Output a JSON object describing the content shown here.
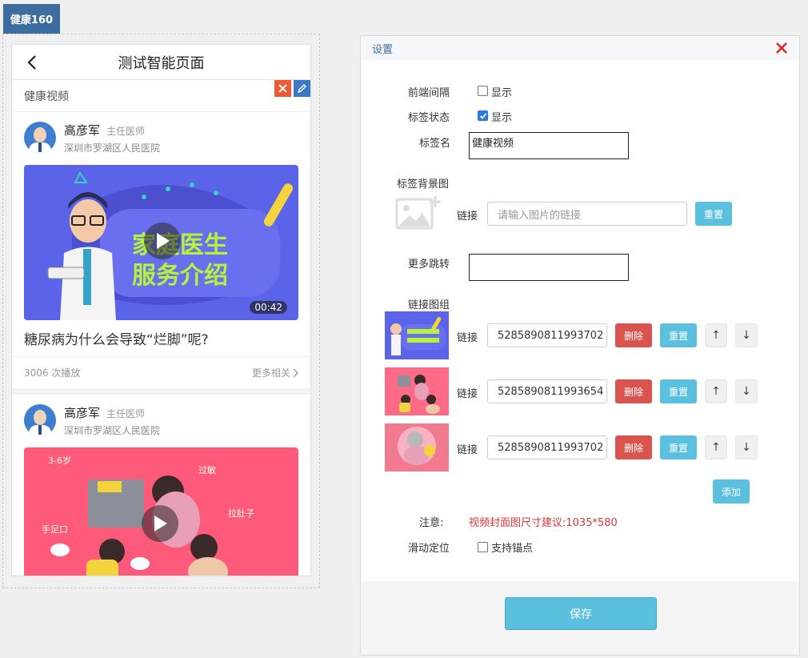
{
  "brand": {
    "label": "健康160"
  },
  "phone": {
    "title": "测试智能页面",
    "section_title": "健康视频",
    "cards": [
      {
        "doctor_name": "高彦军",
        "doctor_title": "主任医师",
        "hospital": "深圳市罗湖区人民医院",
        "video_caption_line1": "家庭医生",
        "video_caption_line2": "服务介绍",
        "duration": "00:42",
        "title": "糖尿病为什么会导致“烂脚”呢?",
        "plays": "3006 次播放",
        "more": "更多相关"
      },
      {
        "doctor_name": "高彦军",
        "doctor_title": "主任医师",
        "hospital": "深圳市罗湖区人民医院",
        "video_text_a": "3-6岁",
        "video_text_b": "过敏",
        "video_text_c": "拉肚子",
        "video_text_d": "手足口"
      }
    ]
  },
  "settings": {
    "title": "设置",
    "front_gap_label": "前端间隔",
    "front_gap_option": "显示",
    "front_gap_checked": false,
    "tag_status_label": "标签状态",
    "tag_status_option": "显示",
    "tag_status_checked": true,
    "tag_name_label": "标签名",
    "tag_name_value": "健康视频",
    "tag_bg_label": "标签背景图",
    "link_label": "链接",
    "link_placeholder": "请输入图片的链接",
    "reset_label": "重置",
    "more_jump_label": "更多跳转",
    "more_jump_value": "",
    "link_group_label": "链接图组",
    "delete_label": "删除",
    "up_label": "↑",
    "down_label": "↓",
    "link_group": [
      {
        "value": "5285890811993702"
      },
      {
        "value": "5285890811993654"
      },
      {
        "value": "5285890811993702"
      }
    ],
    "add_label": "添加",
    "note_label": "注意:",
    "note_text": "视频封面图尺寸建议:1035*580",
    "scroll_label": "滑动定位",
    "scroll_option": "支持锚点",
    "scroll_checked": false,
    "save_label": "保存"
  },
  "colors": {
    "brand": "#3c6d9e",
    "accent": "#5bc0de",
    "danger": "#d9534f",
    "note": "#d9383a"
  }
}
